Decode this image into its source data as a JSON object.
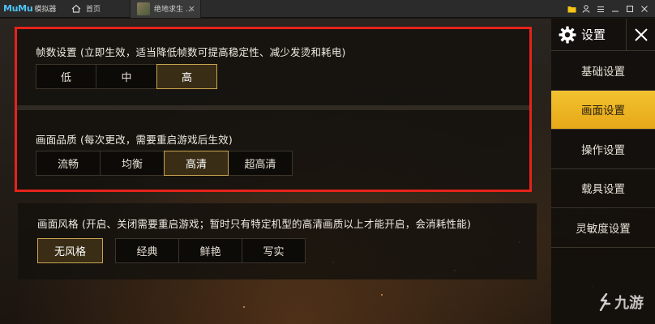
{
  "topbar": {
    "logo_mark": "MuMu",
    "logo_sub": "模拟器",
    "home_label": "首页",
    "game_tab_label": "绝地求生 ...",
    "close_glyph": "×"
  },
  "frame_setting": {
    "title": "帧数设置 (立即生效，适当降低帧数可提高稳定性、减少发烫和耗电)",
    "options": [
      "低",
      "中",
      "高"
    ],
    "selected": "高"
  },
  "quality_setting": {
    "title": "画面品质 (每次更改，需要重启游戏后生效)",
    "options": [
      "流畅",
      "均衡",
      "高清",
      "超高清"
    ],
    "selected": "高清"
  },
  "style_setting": {
    "title": "画面风格 (开启、关闭需要重启游戏；暂时只有特定机型的高清画质以上才能开启，会消耗性能)",
    "options": [
      "无风格",
      "经典",
      "鲜艳",
      "写实"
    ],
    "selected": "无风格"
  },
  "sidebar": {
    "title": "设置",
    "items": [
      "基础设置",
      "画面设置",
      "操作设置",
      "载具设置",
      "灵敏度设置"
    ],
    "active": "画面设置"
  },
  "watermark": {
    "text": "九游"
  },
  "colors": {
    "highlight_border": "#e5231b",
    "active_sidebar": "#f2c230",
    "active_option_border": "#c9a552"
  }
}
